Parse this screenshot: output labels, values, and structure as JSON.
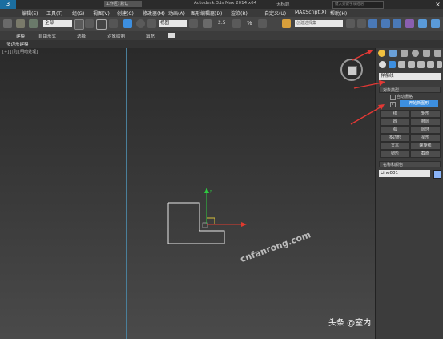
{
  "app": {
    "title": "Autodesk 3ds Max 2014 x64",
    "file_name": "无标题",
    "workspace": "工作区: 默认",
    "search_placeholder": "键入关键字或短语"
  },
  "menubar": {
    "items": [
      "编辑(E)",
      "工具(T)",
      "组(G)",
      "视图(V)",
      "创建(C)",
      "修改器(M)",
      "动画(A)",
      "图形编辑器(D)",
      "渲染(R)",
      "自定义(U)",
      "MAXScript(X)",
      "帮助(H)"
    ]
  },
  "toolbar": {
    "selection_filter": "全部",
    "view_dropdown": "视图",
    "spinner_value": "2.5",
    "percent_label": "%",
    "named_selection_placeholder": "创建选择集"
  },
  "ribbon": {
    "tabs": [
      "建模",
      "自由形式",
      "选择",
      "对象绘制",
      "填充"
    ],
    "sub_label": "多边形建模"
  },
  "viewport": {
    "label": "[+] [顶] [明暗处理]",
    "watermark": "cnfanrong.com"
  },
  "command_panel": {
    "category_dropdown": "样条线",
    "object_type_header": "对象类型",
    "auto_grid_label": "自动栅格",
    "start_new_shape_label": "开始新图形",
    "start_new_shape_checked": true,
    "buttons": [
      [
        "线",
        "矩形"
      ],
      [
        "圆",
        "椭圆"
      ],
      [
        "弧",
        "圆环"
      ],
      [
        "多边形",
        "星形"
      ],
      [
        "文本",
        "螺旋线"
      ],
      [
        "卵形",
        "截面"
      ]
    ],
    "name_color_header": "名称和颜色",
    "object_name": "Line001",
    "object_color": "#8ab4f8"
  },
  "footer": {
    "source_text": "头条 @室内"
  },
  "colors": {
    "accent_blue": "#3d8fe0",
    "annotation_red": "#e53935",
    "shape_white": "#e8e8e8",
    "gizmo_green": "#2ecc40",
    "gizmo_red": "#e03a2e"
  }
}
